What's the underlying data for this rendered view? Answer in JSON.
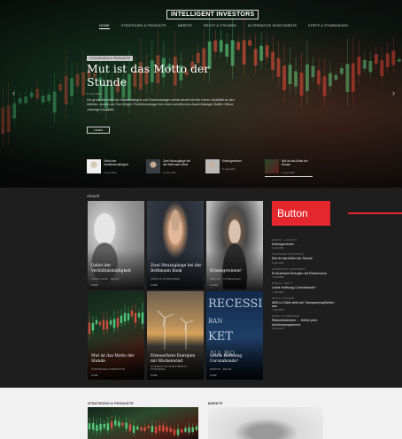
{
  "header": {
    "brand": "INTELLIGENT INVESTORS",
    "nav": [
      "HOME",
      "STRATEGIEN & PRODUKTE",
      "MÄRKTE",
      "RECHT & STEUERN",
      "ALTERNATIVE INVESTMENTS",
      "KÖPFE & STIMMUNGEN"
    ]
  },
  "hero": {
    "tag": "STRATEGIEN & PRODUKTE",
    "title": "Mut ist das Motto der Stunde",
    "date": "8. April 2020",
    "excerpt": "Die große Mehrheit der Marktstrategen und Fondsmanager womit derzeit mit der hohen Volatilität an den Märkten. Anders als Tom Wright, Portfoliomanager bei einem schottischen Asset Manager Baillie Gifford. „Niedrige Volatilität...",
    "button": "LESEN",
    "thumbs": [
      {
        "title": "Gebot der Verhältnismäßigkeit",
        "date": "8. April 2020"
      },
      {
        "title": "Zwei Neuzugänge bei der Bethmann Bank",
        "date": "8. April 2020"
      },
      {
        "title": "Krisengewinner",
        "date": "8. April 2020"
      },
      {
        "title": "Mut ist das Motto der Stunde",
        "date": "8. April 2020"
      }
    ]
  },
  "aktuell": {
    "label": "Aktuell",
    "cards": [
      {
        "title": "Gebot der Verhältnismäßigkeit",
        "meta": "COMPLIANCE · RECHT",
        "date": "8 ANR"
      },
      {
        "title": "Zwei Neuzugänge bei der Bethmann Bank",
        "meta": "KÖPFE & STIMMUNGEN",
        "date": "8 ANR"
      },
      {
        "title": "Krisengewinner",
        "meta": "MÄRKTE · STIMMUNGEN",
        "date": "10 ANR"
      },
      {
        "title": "Mut ist das Motto der Stunde",
        "meta": "STRATEGIEN & PRODUKTE",
        "date": "8 ANR"
      },
      {
        "title": "Erneuerbare Energien mit Rückenwind",
        "meta": "ALTERNATIVE INVESTMENTS · STRATEGIE",
        "date": "8 ANR"
      },
      {
        "title": "Letzte Hoffnung Coronabonds?",
        "meta": "MÄRKTE · RECHT",
        "date": "8 ANR"
      }
    ],
    "button": "Button",
    "side": [
      {
        "meta": "MÄRKTE · LIVE BLOG",
        "title": "Krisengewinner",
        "date": "8. April 2020"
      },
      {
        "meta": "STRATEGIEN & PRODUKTE",
        "title": "Mut ist das Motto der Stunde",
        "date": "8. April 2020"
      },
      {
        "meta": "ALTERNATIVE INVESTMENTS",
        "title": "Erneuerbare Energien mit Rückenwind",
        "date": "7. April 2020"
      },
      {
        "meta": "MÄRKTE · RECHT",
        "title": "Letzte Hoffnung Coronabonds?",
        "date": "7. April 2020"
      },
      {
        "meta": "RECHT & STEUERN",
        "title": "ABS-U-Cable sieht auf Transparenzpflichten aus",
        "date": "7. April 2020"
      },
      {
        "meta": "KÖPFE & STIMMUNGEN",
        "title": "Risikodividenden … Helfen jetzt Anleihenprogramme",
        "date": "6. April 2020"
      }
    ]
  },
  "bottom": {
    "left_label": "STRATEGIEN & PRODUKTE",
    "right_label": "MÄRKTE"
  },
  "colors": {
    "accent_red": "#e4262d",
    "dark_bg": "#1e1e1e",
    "light_bg": "#f1f1f1"
  }
}
